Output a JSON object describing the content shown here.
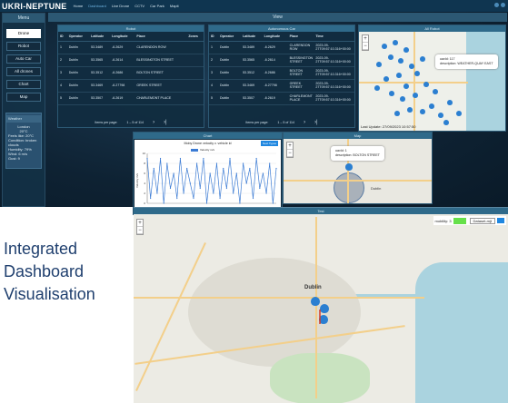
{
  "app": {
    "brand": "UKRI-NEPTUNE",
    "nav": [
      "Home",
      "Dashboard",
      "Live Drone",
      "CCTV",
      "Car Park",
      "Mapit"
    ]
  },
  "sidebar": {
    "title": "Menu",
    "buttons": [
      "Drone",
      "Robot",
      "Auto Car",
      "All drones",
      "Chart",
      "Map"
    ],
    "weather": {
      "header": "Weather",
      "city": "London",
      "temp": "20°C",
      "feels": "Feels like: 20°C",
      "conditions": "Condition: broken clouds",
      "humidity": "Humidity: 79%",
      "wind": "Wind: 6 m/s",
      "gust": "Gust: 9"
    }
  },
  "view": {
    "title": "View",
    "robot": {
      "title": "Robot",
      "columns": [
        "ID",
        "Operator",
        "Latitude",
        "Longitude",
        "Place",
        "Zones"
      ],
      "rows": [
        [
          "1",
          "Dublin",
          "53.3489",
          "-6.2629",
          "CLARENDON ROW",
          ""
        ],
        [
          "2",
          "Dublin",
          "53.3565",
          "-6.2614",
          "BLESSINGTON STREET",
          ""
        ],
        [
          "3",
          "Dublin",
          "53.3512",
          "-6.2686",
          "BOLTON STREET",
          ""
        ],
        [
          "4",
          "Dublin",
          "53.3469",
          "-6.27798",
          "GREEK STREET",
          ""
        ],
        [
          "5",
          "Dublin",
          "53.3507",
          "-6.2619",
          "CHARLEMONT PLACE",
          ""
        ]
      ],
      "items_label": "Items per page:",
      "range": "1 – 5 of 114"
    },
    "autocar": {
      "title": "Autonomous Car",
      "columns": [
        "ID",
        "Operator",
        "Latitude",
        "Longitude",
        "Place",
        "Time"
      ],
      "rows": [
        [
          "1",
          "Dublin",
          "53.3489",
          "-6.2629",
          "CLARENDON ROW",
          "2023-09-27T09:57:10.316+00:00"
        ],
        [
          "2",
          "Dublin",
          "53.3565",
          "-6.2614",
          "BLESSINGTON STREET",
          "2023-09-27T09:57:10.316+00:00"
        ],
        [
          "3",
          "Dublin",
          "53.3512",
          "-6.2686",
          "BOLTON STREET",
          "2023-09-27T09:57:10.316+00:00"
        ],
        [
          "4",
          "Dublin",
          "53.3469",
          "-6.27798",
          "GREEK STREET",
          "2023-09-27T09:57:10.316+00:00"
        ],
        [
          "5",
          "Dublin",
          "53.3507",
          "-6.2619",
          "CHARLEMONT PLACE",
          "2023-09-27T09:57:10.316+00:00"
        ]
      ],
      "items_label": "Items per page:",
      "range": "1 – 5 of 114"
    },
    "allrobot": {
      "title": "All Robot",
      "popup_line1": "uavId: 117",
      "popup_line2": "description: WEATHER-QUAY EAST",
      "last_update": "Last Update: 27/09/2023 10:57:50"
    },
    "chart": {
      "title": "Chart",
      "inner_title": "Moby Drone velocity v. vehicle id",
      "button": "Next Types",
      "legend": "Velocity m/s",
      "ylabel": "Velocity m/s"
    },
    "map": {
      "title": "Map",
      "popup_line1": "uavId: 1",
      "popup_line2": "description: BOLTON STREET",
      "label": "Dublin"
    },
    "test": {
      "title": "Test",
      "mobility_label": "mobility: 3",
      "select_value": "Dataset-mjt",
      "city": "Dublin"
    }
  },
  "caption": {
    "line1": "Integrated",
    "line2": "Dashboard",
    "line3": "Visualisation"
  },
  "colors": {
    "accent": "#2f6a8a",
    "pin": "#2b7fd1",
    "green_legend": "#66e04a"
  },
  "chart_data": {
    "type": "line",
    "title": "Moby Drone velocity v. vehicle id",
    "ylabel": "Velocity m/s",
    "ylim": [
      0,
      10
    ],
    "series": [
      {
        "name": "Velocity m/s",
        "values": [
          9,
          1,
          7,
          2,
          9,
          0,
          8,
          3,
          6,
          1,
          9,
          2,
          7,
          4,
          1,
          8,
          3,
          9,
          0,
          6,
          2,
          8,
          1,
          7,
          3,
          9,
          2,
          6,
          0,
          8,
          4,
          7,
          1,
          9,
          3,
          6,
          2,
          8,
          0,
          7
        ]
      }
    ]
  }
}
